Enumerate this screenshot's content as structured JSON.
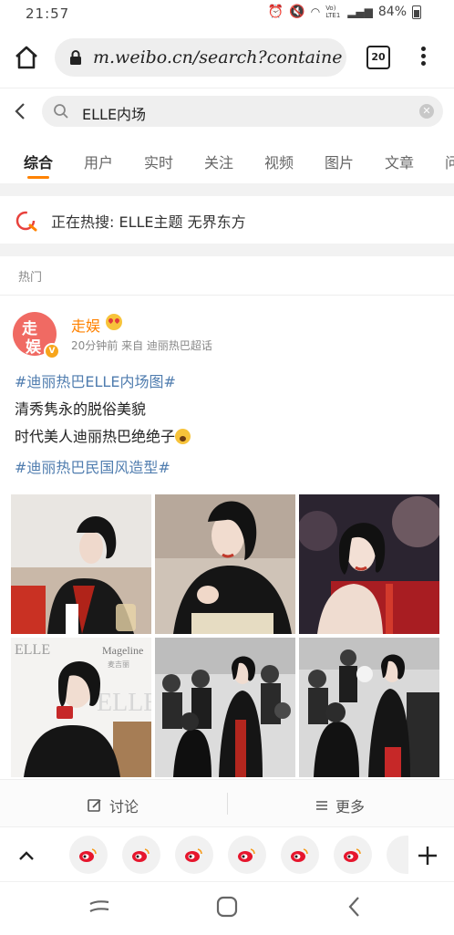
{
  "status": {
    "time": "21:57",
    "signal": "Vo) LTE1",
    "battery": "84%"
  },
  "browser": {
    "url": "m.weibo.cn/search?containe",
    "tab_count": "20"
  },
  "search": {
    "query": "ELLE内场"
  },
  "category_tabs": [
    "综合",
    "用户",
    "实时",
    "关注",
    "视频",
    "图片",
    "文章",
    "问"
  ],
  "hot_search": {
    "text": "正在热搜: ELLE主题 无界东方"
  },
  "section": {
    "label": "热门"
  },
  "post": {
    "avatar_text": [
      "走",
      "娱"
    ],
    "verified_badge": "V",
    "username": "走娱",
    "meta": "20分钟前 来自 迪丽热巴超话",
    "lines": [
      {
        "type": "tag",
        "text": "#迪丽热巴ELLE内场图#"
      },
      {
        "type": "text",
        "text": "清秀隽永的脱俗美貌"
      },
      {
        "type": "text",
        "text": "时代美人迪丽热巴绝绝子"
      },
      {
        "type": "tag",
        "text": "#迪丽热巴民国风造型#"
      }
    ],
    "photo_elle_text": "ELLE",
    "photo_brand_text": "Mageline",
    "photo_brand_sub": "麦吉丽"
  },
  "actions": {
    "discuss": "讨论",
    "more": "更多"
  },
  "colors": {
    "accent": "#ff8200",
    "link": "#507daf"
  }
}
